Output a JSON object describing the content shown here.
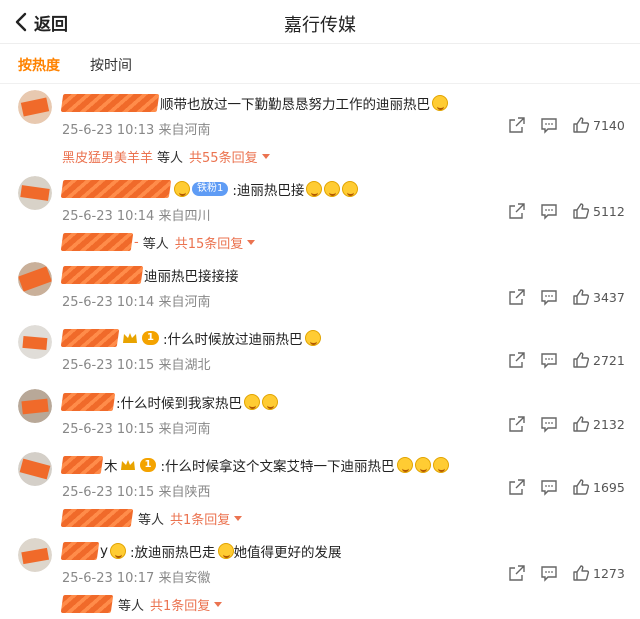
{
  "header": {
    "back_label": "返回",
    "title": "嘉行传媒"
  },
  "sort_tabs": [
    {
      "label": "按热度"
    },
    {
      "label": "按时间"
    }
  ],
  "comments": [
    {
      "name_suffix": "顺带也放过一下勤勤恳恳努力工作的迪丽热巴",
      "date": "25-6-23 10:13",
      "location": "来自河南",
      "likes": "7140",
      "reply_name": "黑皮猛男美羊羊",
      "reply_etc": "等人",
      "reply_count": "共55条回复"
    },
    {
      "fan_badge": "铁粉1",
      "name_suffix": ":迪丽热巴接",
      "date": "25-6-23 10:14",
      "location": "来自四川",
      "likes": "5112",
      "reply_name_tail": "-",
      "reply_etc": "等人",
      "reply_count": "共15条回复"
    },
    {
      "name_suffix": "迪丽热巴接接接",
      "date": "25-6-23 10:14",
      "location": "来自河南",
      "likes": "3437"
    },
    {
      "level": "1",
      "name_suffix": ":什么时候放过迪丽热巴",
      "date": "25-6-23 10:15",
      "location": "来自湖北",
      "likes": "2721"
    },
    {
      "name_suffix": ":什么时候到我家热巴",
      "date": "25-6-23 10:15",
      "location": "来自河南",
      "likes": "2132"
    },
    {
      "name_visible": "木",
      "level": "1",
      "name_suffix": ":什么时候拿这个文案艾特一下迪丽热巴",
      "date": "25-6-23 10:15",
      "location": "来自陕西",
      "likes": "1695",
      "reply_etc": "等人",
      "reply_count": "共1条回复"
    },
    {
      "name_visible": "y",
      "name_suffix": ":放迪丽热巴走",
      "name_suffix2": "她值得更好的发展",
      "date": "25-6-23 10:17",
      "location": "来自安徽",
      "likes": "1273",
      "reply_etc": "等人",
      "reply_count": "共1条回复"
    }
  ],
  "colors": {
    "accent": "#ff8200",
    "reply_link": "#eb7350",
    "meta": "#888888"
  },
  "icons": {
    "back": "chevron-left-icon",
    "share": "share-icon",
    "reply": "comment-icon",
    "like": "thumbs-up-icon"
  }
}
